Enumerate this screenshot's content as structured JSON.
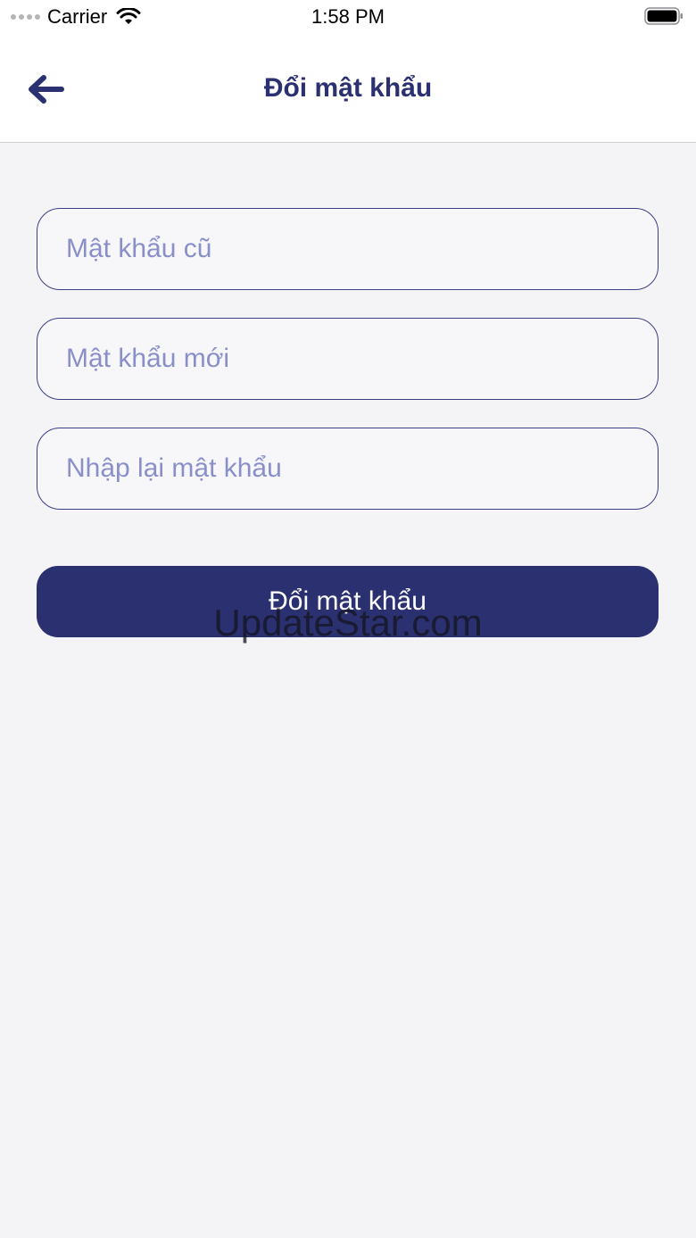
{
  "status_bar": {
    "carrier": "Carrier",
    "time": "1:58 PM",
    "wifi_icon": "wifi-icon",
    "battery_icon": "battery-icon"
  },
  "nav": {
    "title": "Đổi mật khẩu",
    "back_icon": "arrow-left-icon"
  },
  "form": {
    "old_password_placeholder": "Mật khẩu cũ",
    "new_password_placeholder": "Mật khẩu mới",
    "confirm_password_placeholder": "Nhập lại mật khẩu",
    "submit_label": "Đổi mật khẩu"
  },
  "watermark": "UpdateStar.com",
  "colors": {
    "primary": "#2b3070",
    "placeholder": "#8a8fc9",
    "background": "#f4f4f6"
  }
}
